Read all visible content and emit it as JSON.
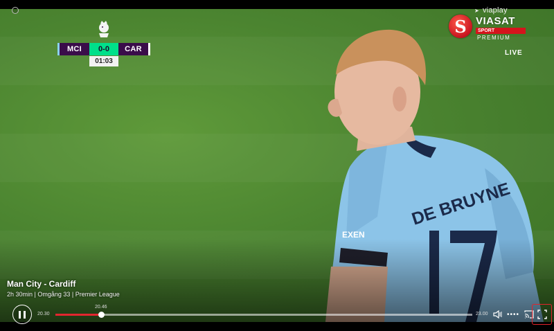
{
  "scoreboard": {
    "home": "MCI",
    "score": "0-0",
    "away": "CAR",
    "clock": "01:03"
  },
  "broadcaster": {
    "viaplay": "viaplay",
    "logo_letter": "S",
    "name": "VIASAT",
    "sport": "SPORT",
    "premium": "PREMIUM",
    "live": "LIVE"
  },
  "player": {
    "shirt_name": "DE BRUYNE",
    "number": "17",
    "sponsor": "EXEN"
  },
  "program": {
    "title": "Man City - Cardiff",
    "meta": "2h 30min | Omgång 33 | Premier League"
  },
  "player_controls": {
    "time_start": "20.30",
    "time_end": "23.00",
    "hover_time": "20.46",
    "progress": 0.11,
    "more_label": "••••"
  },
  "colors": {
    "accent": "#e2262f",
    "score_bg": "#00e08a",
    "team_bg": "#3a0d4a",
    "shirt": "#8cc4e8"
  },
  "icons": [
    "corner-icon",
    "pause-icon",
    "volume-icon",
    "more-icon",
    "cast-icon",
    "fullscreen-icon",
    "premier-league-crest-icon"
  ]
}
